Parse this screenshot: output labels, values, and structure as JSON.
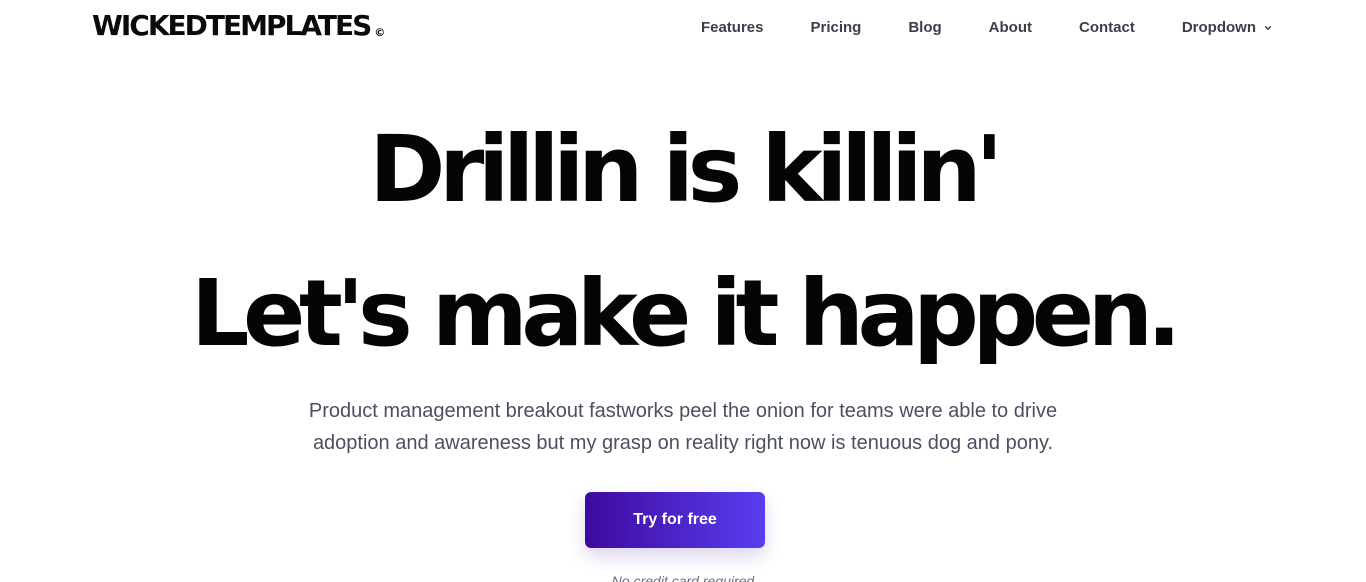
{
  "header": {
    "logo_text": "WICKEDTEMPLATES",
    "logo_mark": "©",
    "nav": {
      "features": "Features",
      "pricing": "Pricing",
      "blog": "Blog",
      "about": "About",
      "contact": "Contact",
      "dropdown": "Dropdown"
    },
    "dropdown_icon": "chevron-down-icon"
  },
  "hero": {
    "headline_line1": "Drillin is killin'",
    "headline_line2": "Let's make it happen.",
    "subtitle": "Product management breakout fastworks peel the onion for teams were able to drive adoption and awareness but my grasp on reality right now is tenuous dog and pony.",
    "cta_label": "Try for free",
    "note": "No credit card required"
  },
  "colors": {
    "cta_gradient_start": "#3e0a9e",
    "cta_gradient_end": "#5a3df0",
    "nav_text": "#3a3f4a",
    "subtitle_text": "#4b5060"
  }
}
